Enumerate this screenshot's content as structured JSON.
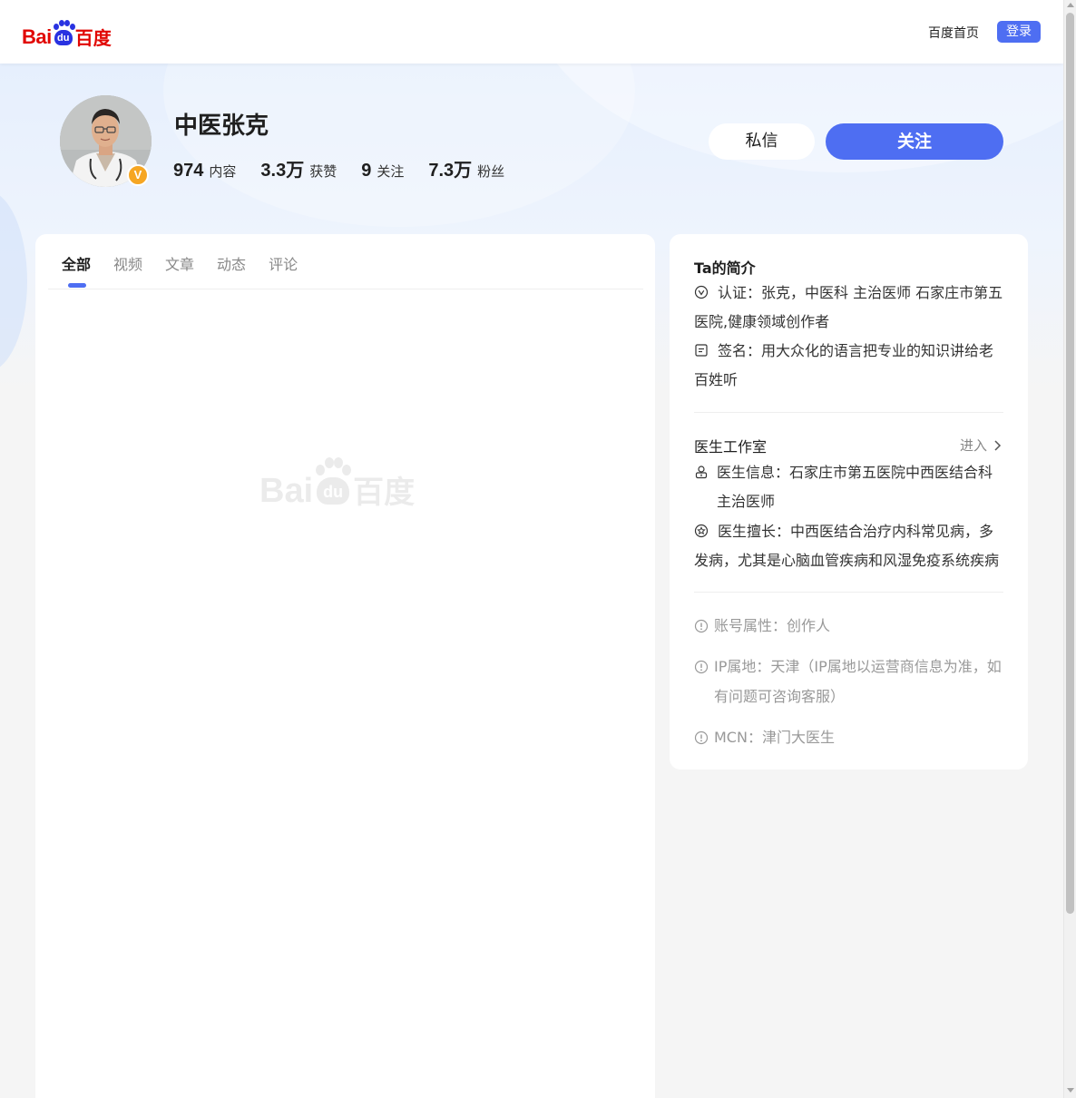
{
  "header": {
    "logo_text_latin": "Bai",
    "logo_text_paw": "du",
    "logo_text_cn": "百度",
    "home_link": "百度首页",
    "login_label": "登录"
  },
  "profile": {
    "name": "中医张克",
    "verified_badge": "V",
    "stats": [
      {
        "value": "974",
        "label": "内容"
      },
      {
        "value": "3.3万",
        "label": "获赞"
      },
      {
        "value": "9",
        "label": "关注"
      },
      {
        "value": "7.3万",
        "label": "粉丝"
      }
    ],
    "message_label": "私信",
    "follow_label": "关注"
  },
  "tabs": [
    "全部",
    "视频",
    "文章",
    "动态",
    "评论"
  ],
  "intro": {
    "title": "Ta的简介",
    "certification": "认证：张克，中医科 主治医师 石家庄市第五医院,健康领域创作者",
    "signature": "签名：用大众化的语言把专业的知识讲给老百姓听"
  },
  "studio": {
    "title": "医生工作室",
    "enter_label": "进入",
    "doctor_info": "医生信息：石家庄市第五医院中西医结合科 主治医师",
    "doctor_specialty": "医生擅长：中西医结合治疗内科常见病，多发病，尤其是心脑血管疾病和风湿免疫系统疾病"
  },
  "account": {
    "type": "账号属性：创作人",
    "ip": "IP属地：天津（IP属地以运营商信息为准，如有问题可咨询客服）",
    "mcn": "MCN：津门大医生"
  },
  "colors": {
    "accent": "#4e6ef2",
    "logo_red": "#e10602",
    "logo_blue": "#2932e1",
    "badge": "#f6a623"
  }
}
